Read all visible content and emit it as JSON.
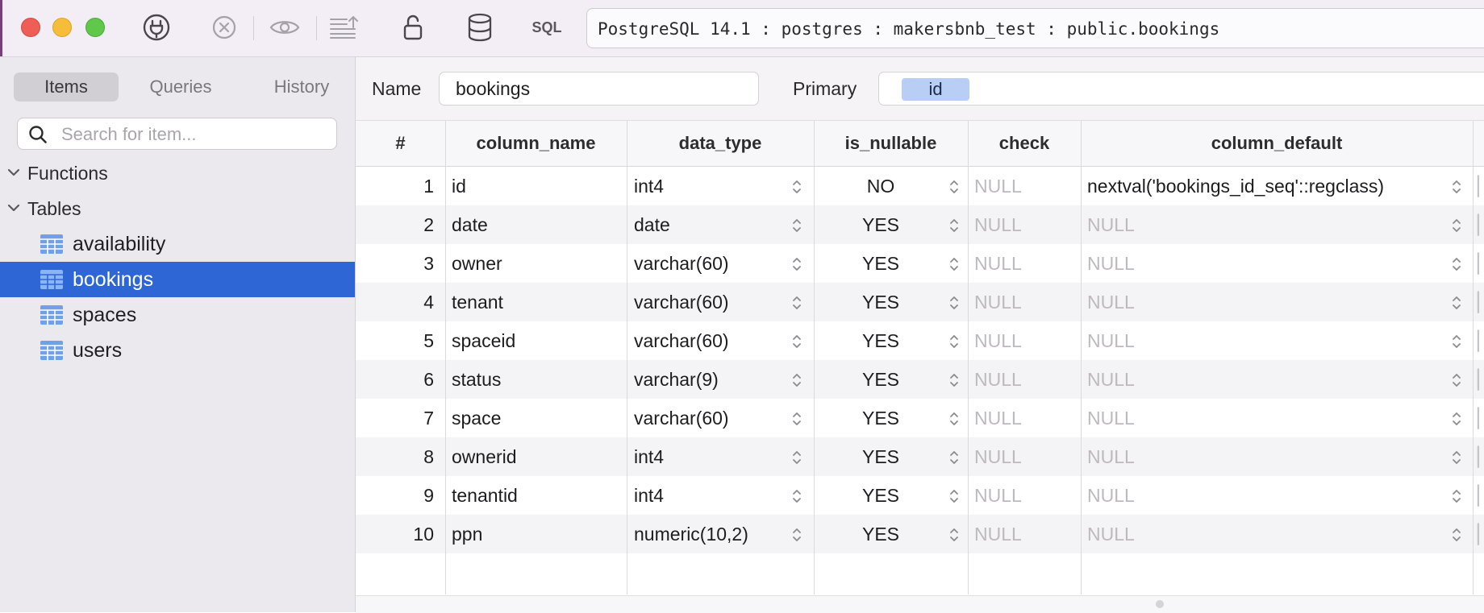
{
  "toolbar": {
    "connection": "PostgreSQL 14.1 : postgres : makersbnb_test : public.bookings",
    "sql_label": "SQL",
    "icons": [
      "plug-icon",
      "close-circle-icon",
      "eye-icon",
      "import-icon",
      "lock-open-icon",
      "database-icon"
    ]
  },
  "sidebar": {
    "tabs": [
      "Items",
      "Queries",
      "History"
    ],
    "active_tab": "Items",
    "search_placeholder": "Search for item...",
    "groups": [
      {
        "label": "Functions"
      },
      {
        "label": "Tables"
      }
    ],
    "tables": [
      "availability",
      "bookings",
      "spaces",
      "users"
    ],
    "selected_table": "bookings"
  },
  "structure": {
    "name_label": "Name",
    "name_value": "bookings",
    "primary_label": "Primary",
    "primary_value": "id"
  },
  "grid": {
    "headers": [
      "#",
      "column_name",
      "data_type",
      "is_nullable",
      "check",
      "column_default"
    ],
    "rows": [
      {
        "n": "1",
        "name": "id",
        "type": "int4",
        "nullable": "NO",
        "check": "NULL",
        "default": "nextval('bookings_id_seq'::regclass)"
      },
      {
        "n": "2",
        "name": "date",
        "type": "date",
        "nullable": "YES",
        "check": "NULL",
        "default": "NULL"
      },
      {
        "n": "3",
        "name": "owner",
        "type": "varchar(60)",
        "nullable": "YES",
        "check": "NULL",
        "default": "NULL"
      },
      {
        "n": "4",
        "name": "tenant",
        "type": "varchar(60)",
        "nullable": "YES",
        "check": "NULL",
        "default": "NULL"
      },
      {
        "n": "5",
        "name": "spaceid",
        "type": "varchar(60)",
        "nullable": "YES",
        "check": "NULL",
        "default": "NULL"
      },
      {
        "n": "6",
        "name": "status",
        "type": "varchar(9)",
        "nullable": "YES",
        "check": "NULL",
        "default": "NULL"
      },
      {
        "n": "7",
        "name": "space",
        "type": "varchar(60)",
        "nullable": "YES",
        "check": "NULL",
        "default": "NULL"
      },
      {
        "n": "8",
        "name": "ownerid",
        "type": "int4",
        "nullable": "YES",
        "check": "NULL",
        "default": "NULL"
      },
      {
        "n": "9",
        "name": "tenantid",
        "type": "int4",
        "nullable": "YES",
        "check": "NULL",
        "default": "NULL"
      },
      {
        "n": "10",
        "name": "ppn",
        "type": "numeric(10,2)",
        "nullable": "YES",
        "check": "NULL",
        "default": "NULL"
      }
    ]
  },
  "colors": {
    "selection": "#2f66d6",
    "primary_chip": "#b9cef5",
    "null_text": "#bdbabf",
    "close": "#ee5e56",
    "minimize": "#f6bd3a",
    "zoom": "#5fc84a"
  }
}
